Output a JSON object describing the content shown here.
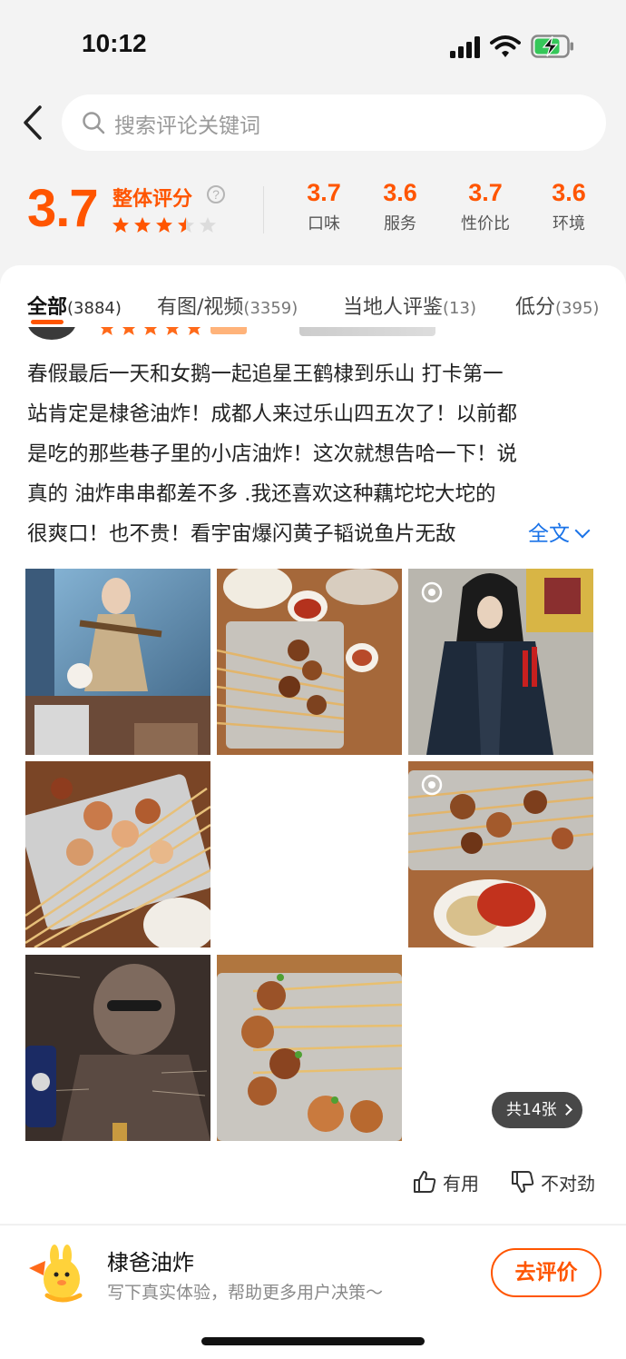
{
  "status_bar": {
    "time": "10:12"
  },
  "search": {
    "placeholder": "搜索评论关键词"
  },
  "rating": {
    "overall": "3.7",
    "overall_label": "整体评分",
    "overall_stars": 3.5,
    "help_glyph": "?",
    "sub_scores": [
      {
        "value": "3.7",
        "label": "口味"
      },
      {
        "value": "3.6",
        "label": "服务"
      },
      {
        "value": "3.7",
        "label": "性价比"
      },
      {
        "value": "3.6",
        "label": "环境"
      }
    ]
  },
  "tabs": [
    {
      "label": "全部",
      "count": "(3884)",
      "active": true
    },
    {
      "label": "有图/视频",
      "count": "(3359)",
      "active": false
    },
    {
      "label": "当地人评鉴",
      "count": "(13)",
      "active": false
    },
    {
      "label": "低分",
      "count": "(395)",
      "active": false
    }
  ],
  "review": {
    "lines": [
      "春假最后一天和女鹅一起追星王鹤棣到乐山 打卡第一",
      "站肯定是棣爸油炸！成都人来过乐山四五次了！以前都",
      "是吃的那些巷子里的小店油炸！这次就想告哈一下！说",
      "真的 油炸串串都差不多 .我还喜欢这种藕坨坨大坨的",
      "很爽口！也不贵！看宇宙爆闪黄子韬说鱼片无敌"
    ],
    "more_label": "全文",
    "photo_count_label": "共14张",
    "useful_label": "有用",
    "wrong_label": "不对劲"
  },
  "photos": [
    {
      "name": "photo-actor-poster-restaurant"
    },
    {
      "name": "photo-skewers-tray-sauce"
    },
    {
      "name": "photo-actor-costume-skewers"
    },
    {
      "name": "photo-fried-skewers-table"
    },
    {
      "name": "photo-blank"
    },
    {
      "name": "photo-skewers-chili-powder"
    },
    {
      "name": "photo-graffiti-wall-portrait"
    },
    {
      "name": "photo-lotus-root-skewers"
    }
  ],
  "bottom": {
    "shop_name": "棣爸油炸",
    "hint": "写下真实体验，帮助更多用户决策～",
    "review_button": "去评价"
  },
  "colors": {
    "accent": "#ff5500",
    "link": "#1a73e8",
    "text": "#222222"
  }
}
